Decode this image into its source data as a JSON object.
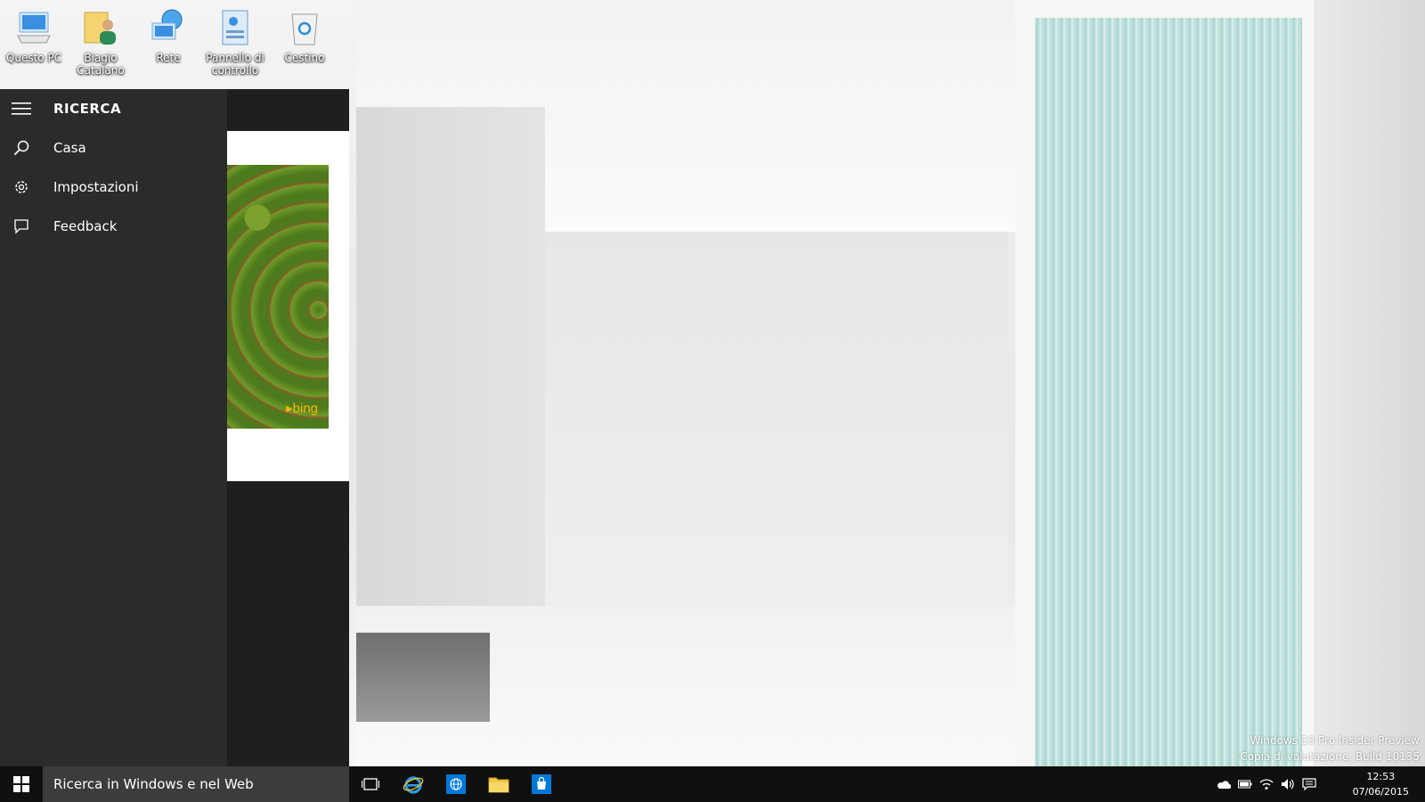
{
  "desktop": {
    "icons": [
      {
        "label": "Questo PC",
        "icon": "computer-icon"
      },
      {
        "label": "Biagio Catalano",
        "icon": "user-folder-icon"
      },
      {
        "label": "Rete",
        "icon": "network-icon"
      },
      {
        "label": "Pannello di controllo",
        "icon": "control-panel-icon"
      },
      {
        "label": "Cestino",
        "icon": "recycle-bin-icon"
      }
    ],
    "watermark": {
      "line1": "Windows 10 Pro Insider Preview",
      "line2": "Copia di valutazione. Build 10135"
    }
  },
  "search_pane": {
    "title": "RICERCA",
    "items": [
      {
        "label": "Casa",
        "icon": "search-icon"
      },
      {
        "label": "Impostazioni",
        "icon": "gear-icon"
      },
      {
        "label": "Feedback",
        "icon": "feedback-icon"
      }
    ],
    "bing_logo": "bing"
  },
  "taskbar": {
    "search_placeholder": "Ricerca in Windows e nel Web",
    "pinned": [
      "task-view-icon",
      "internet-explorer-icon",
      "globe-app-icon",
      "file-explorer-icon",
      "store-icon"
    ],
    "tray_icons": [
      "onedrive-icon",
      "battery-icon",
      "wifi-icon",
      "volume-icon",
      "action-center-icon"
    ],
    "time": "12:53",
    "date": "07/06/2015"
  },
  "colors": {
    "pane_bg": "#2b2b2b",
    "taskbar_bg": "#101010",
    "search_box_bg": "#3c3c3c",
    "accent": "#0078d7",
    "bing": "#f7b900"
  }
}
